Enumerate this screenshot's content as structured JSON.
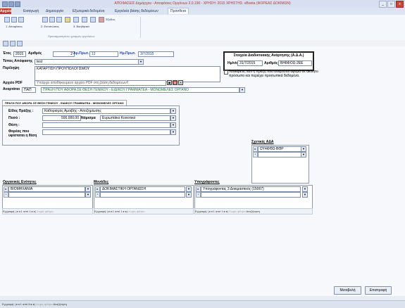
{
  "titlebar": {
    "title": "ΑΠΟΦΑΣΕΙΣ Δημάρχου - Αποφάσεις Οργάνων 2.0.190 - ΧΡΗΣΗ: 2015 ΧΡΗΣΤΗΣ: sBoeta (ΦΟΡΕΑΣ ΔΟΚΙΜΩΝ)",
    "close": "x"
  },
  "ribbon": {
    "tabs": [
      "Αρχείο",
      "Εισαγωγή",
      "Δημιουργία",
      "Εξωτερικά δεδομένα",
      "Εργαλεία βάσης δεδομένων",
      "Πρόσθετα"
    ],
    "exodos": "Έξοδος",
    "groups": [
      "1. Αποφάσεις",
      "2. Εκτυπώσεις",
      "3. Βοηθητικά"
    ],
    "custom_toolbars": "Προσαρμοσμένες γραμμές εργαλείων"
  },
  "form": {
    "etos_label": "Έτος",
    "etos": "2015",
    "arithmos_label": "Αριθμός",
    "arithmos": "2",
    "ar_prot_label": "Αρ.Πρωτ.",
    "ar_prot": "12",
    "im_prot_label": "Ημ.Πρωτ.",
    "im_prot": "3/7/2015",
    "typos_label": "Τύπος Απόφασης",
    "typos": "test",
    "perilipsi_label": "Περίληψη",
    "perilipsi": "ΚΑΤΑΡΤΙΣΗ ΠΡΟΫΠΟΛΟΓΙΣΜΟΥ",
    "arxeio_pdf_label": "Αρχείο PDF",
    "arxeio_pdf_hint": "Υπάρχει αποθηκευμένο αρχείο PDF στη βάση δεδομένων!!",
    "anartisi_label": "Αναρτάται",
    "anartisi_code": "ΠΑΠ",
    "anartisi_text": "ΠΡΑΞΗ ΠΟΥ ΑΦΟΡΑ ΣΕ ΘΕΣΗ ΓΕΝΙΚΟΥ - ΕΙΔΙΚΟΥ ΓΡΑΜΜΑΤΕΑ - ΜΟΝΟΜΕΛΕΣ ΟΡΓΑΝΟ",
    "ada_title": "Στοιχεία Διαδικτυακής Ανάρτησης (Α.Δ.Α.)",
    "ada_date_label": "Ημ/νία",
    "ada_date": "31/7/2015",
    "ada_num_label": "Αριθμός",
    "ada_num": "ΒΗ8ΦΟΩ-2ΕΕ",
    "checkbox_text": "Τσεκάρετε, εάν η πράξη που αναρτάται αφορά σε ακίνητο πρόσωπο και περιέχει προσωπικά δεδομένα."
  },
  "tab": {
    "header": "ΠΡΑΞΗ ΠΟΥ ΑΦΟΡΑ ΣΕ ΘΕΣΗ ΓΕΝΙΚΟΥ - ΕΙΔΙΚΟΥ ΓΡΑΜΜΑΤΕΑ - ΜΟΝΟΜΕΛΕΣ ΟΡΓΑΝΟ",
    "eidos_label": "Είδος Πράξης :",
    "eidos": "Καθορισμός Αμοιβής - Αποζημίωσης",
    "poso_label": "Ποσό :",
    "poso": "500.000,00",
    "nomisma_label": "Νόμισμα",
    "nomisma": "Ευρωπαϊκό Κοινοτικό",
    "thesi_label": "Θέση :",
    "foreas_label": "Φορέας που υφίσταται η θέση"
  },
  "sxetikes": {
    "title": "Σχετικές ΑΔΑ",
    "row1": "ΩΥ4ΦΘΩ-ΒΘΡ"
  },
  "subforms": {
    "organika_title": "Οργανικές Ενότητες",
    "organika_row": "ΒΙΟΜΗΧΑΝΙΑ",
    "monades_title": "Μονάδες",
    "monades_row": "ΔΟΚΙΜΑΣΤΙΚΗ ΟΡΓΑΝΩΣΗ",
    "ypografontes_title": "Υπογράφοντες",
    "ypografontes_row": "Υπογράφοντας 3 Δοκιμαστικός (15067)"
  },
  "nav": {
    "record_label": "Εγγραφή:",
    "position": "1 από 1",
    "no_filter": "Χωρίς φίλτρο",
    "search": "Αναζήτηση"
  },
  "bottom": {
    "metavoli": "Μεταβολή",
    "epistrofi": "Επιστροφή"
  },
  "statusbar": {
    "position": "1 από 8"
  }
}
